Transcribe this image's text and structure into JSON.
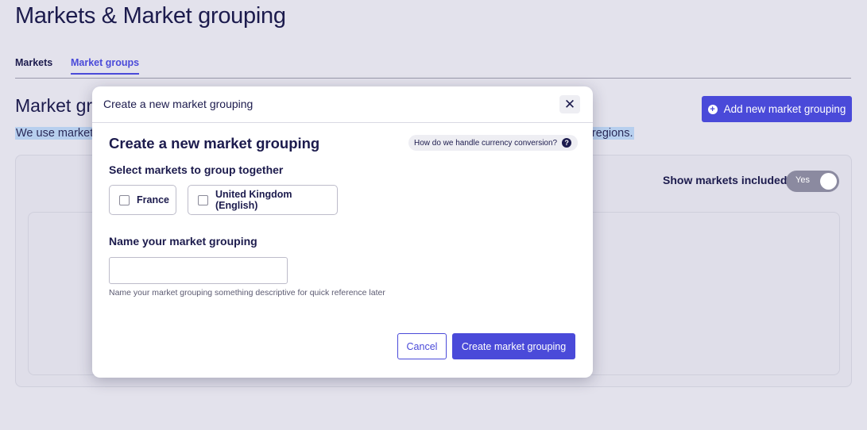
{
  "page": {
    "title": "Markets & Market grouping"
  },
  "tabs": [
    {
      "label": "Markets"
    },
    {
      "label": "Market groups",
      "active": true
    }
  ],
  "section": {
    "title": "Market gr",
    "info_left": "We use market",
    "info_right": "er regions.",
    "add_button_label": "Add new market grouping",
    "add_button_icon": "plus-circle-icon"
  },
  "toggle": {
    "label": "Show markets included",
    "value": "Yes"
  },
  "modal": {
    "header_title": "Create a new market grouping",
    "close_icon": "close-icon",
    "title": "Create a new market grouping",
    "help_text": "How do we handle currency conversion?",
    "help_icon": "question-icon",
    "select_label": "Select markets to group together",
    "markets": [
      {
        "label": "France",
        "checked": false
      },
      {
        "label": "United Kingdom (English)",
        "checked": false
      }
    ],
    "name_label": "Name your market grouping",
    "name_value": "",
    "name_hint": "Name your market grouping something descriptive for quick reference later",
    "cancel_label": "Cancel",
    "create_label": "Create market grouping"
  },
  "colors": {
    "accent": "#4a4ad9",
    "background": "#e3e2ec",
    "text": "#1c1b4d",
    "selection": "#b7cfee"
  }
}
